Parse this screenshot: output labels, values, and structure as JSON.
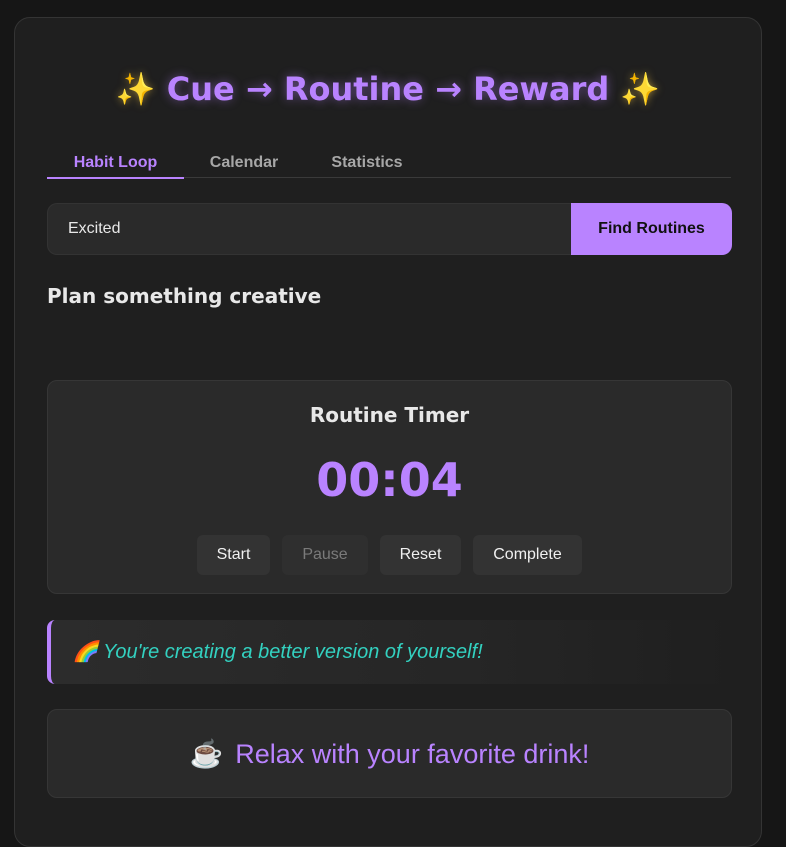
{
  "header": {
    "sparkle_left": "✨",
    "title": "Cue → Routine → Reward",
    "sparkle_right": "✨"
  },
  "tabs": [
    {
      "label": "Habit Loop",
      "active": true
    },
    {
      "label": "Calendar",
      "active": false
    },
    {
      "label": "Statistics",
      "active": false
    }
  ],
  "mood_search": {
    "value": "Excited",
    "button_label": "Find Routines"
  },
  "routine": {
    "heading": "Plan something creative"
  },
  "timer": {
    "title": "Routine Timer",
    "display": "00:04",
    "buttons": {
      "start": "Start",
      "pause": "Pause",
      "reset": "Reset",
      "complete": "Complete"
    }
  },
  "motivation": {
    "emoji": "🌈",
    "text": "You're creating a better version of yourself!"
  },
  "reward": {
    "emoji": "☕",
    "text": "Relax with your favorite drink!"
  },
  "colors": {
    "accent": "#b983ff",
    "quote_text": "#33d1c0",
    "background": "#1f1f1f"
  }
}
